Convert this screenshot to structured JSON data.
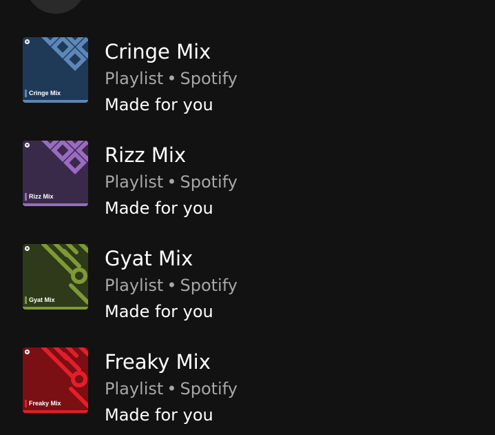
{
  "playlists": [
    {
      "title": "Cringe Mix",
      "type": "Playlist",
      "separator": "•",
      "owner": "Spotify",
      "description": "Made for you",
      "cover_label": "Cringe Mix",
      "cover_bg": "#1f3a57",
      "cover_accent": "#5c87b8",
      "cover_pattern": "squares"
    },
    {
      "title": "Rizz Mix",
      "type": "Playlist",
      "separator": "•",
      "owner": "Spotify",
      "description": "Made for you",
      "cover_label": "Rizz Mix",
      "cover_bg": "#3a2a4a",
      "cover_accent": "#9a6bc0",
      "cover_pattern": "squares"
    },
    {
      "title": "Gyat Mix",
      "type": "Playlist",
      "separator": "•",
      "owner": "Spotify",
      "description": "Made for you",
      "cover_label": "Gyat Mix",
      "cover_bg": "#2f3a1a",
      "cover_accent": "#7d9a35",
      "cover_pattern": "stripes"
    },
    {
      "title": "Freaky Mix",
      "type": "Playlist",
      "separator": "•",
      "owner": "Spotify",
      "description": "Made for you",
      "cover_label": "Freaky Mix",
      "cover_bg": "#7a0f14",
      "cover_accent": "#e31e2a",
      "cover_pattern": "stripes"
    }
  ],
  "icons": {
    "cover_logo": "spotify-logo-icon",
    "profile": "avatar"
  }
}
